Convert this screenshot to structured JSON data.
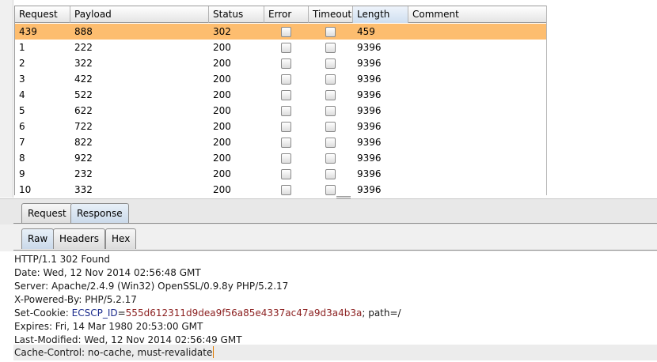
{
  "table": {
    "columns": [
      {
        "key": "request",
        "label": "Request"
      },
      {
        "key": "payload",
        "label": "Payload"
      },
      {
        "key": "status",
        "label": "Status"
      },
      {
        "key": "error",
        "label": "Error"
      },
      {
        "key": "timeout",
        "label": "Timeout"
      },
      {
        "key": "length",
        "label": "Length"
      },
      {
        "key": "comment",
        "label": "Comment"
      }
    ],
    "sorted_column": "length",
    "selected_row": 0,
    "rows": [
      {
        "request": "439",
        "payload": "888",
        "status": "302",
        "error": false,
        "timeout": false,
        "length": "459",
        "comment": ""
      },
      {
        "request": "1",
        "payload": "222",
        "status": "200",
        "error": false,
        "timeout": false,
        "length": "9396",
        "comment": ""
      },
      {
        "request": "2",
        "payload": "322",
        "status": "200",
        "error": false,
        "timeout": false,
        "length": "9396",
        "comment": ""
      },
      {
        "request": "3",
        "payload": "422",
        "status": "200",
        "error": false,
        "timeout": false,
        "length": "9396",
        "comment": ""
      },
      {
        "request": "4",
        "payload": "522",
        "status": "200",
        "error": false,
        "timeout": false,
        "length": "9396",
        "comment": ""
      },
      {
        "request": "5",
        "payload": "622",
        "status": "200",
        "error": false,
        "timeout": false,
        "length": "9396",
        "comment": ""
      },
      {
        "request": "6",
        "payload": "722",
        "status": "200",
        "error": false,
        "timeout": false,
        "length": "9396",
        "comment": ""
      },
      {
        "request": "7",
        "payload": "822",
        "status": "200",
        "error": false,
        "timeout": false,
        "length": "9396",
        "comment": ""
      },
      {
        "request": "8",
        "payload": "922",
        "status": "200",
        "error": false,
        "timeout": false,
        "length": "9396",
        "comment": ""
      },
      {
        "request": "9",
        "payload": "232",
        "status": "200",
        "error": false,
        "timeout": false,
        "length": "9396",
        "comment": ""
      },
      {
        "request": "10",
        "payload": "332",
        "status": "200",
        "error": false,
        "timeout": false,
        "length": "9396",
        "comment": ""
      }
    ]
  },
  "main_tabs": [
    {
      "label": "Request",
      "active": false
    },
    {
      "label": "Response",
      "active": true
    }
  ],
  "sub_tabs": [
    {
      "label": "Raw",
      "active": true
    },
    {
      "label": "Headers",
      "active": false
    },
    {
      "label": "Hex",
      "active": false
    }
  ],
  "response": {
    "status_line": "HTTP/1.1 302 Found",
    "date": "Date: Wed, 12 Nov 2014 02:56:48 GMT",
    "server": "Server: Apache/2.4.9 (Win32) OpenSSL/0.9.8y PHP/5.2.17",
    "powered_by": "X-Powered-By: PHP/5.2.17",
    "set_cookie_prefix": "Set-Cookie: ",
    "cookie_name": "ECSCP_ID",
    "cookie_eq": "=",
    "cookie_value": "555d612311d9dea9f56a85e4337ac47a9d3a4b3a",
    "cookie_suffix": "; path=/",
    "expires": "Expires: Fri, 14 Mar 1980 20:53:00 GMT",
    "last_modified": "Last-Modified: Wed, 12 Nov 2014 02:56:49 GMT",
    "cache_control": "Cache-Control: no-cache, must-revalidate"
  },
  "colors": {
    "selected_row": "#fdbd6f",
    "cookie_name": "#1c2c8c",
    "cookie_value": "#8b1f1f",
    "caret": "#e07b00"
  }
}
